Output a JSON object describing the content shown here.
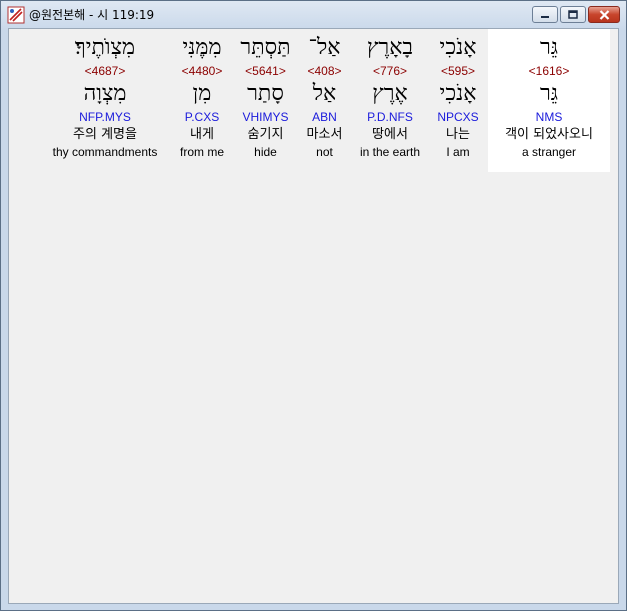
{
  "window": {
    "title": "@원전본해 - 시 119:19",
    "controls": [
      "minimize",
      "maximize",
      "close"
    ]
  },
  "words": [
    {
      "hebrew": "גֵּר",
      "strong": "<1616>",
      "lemma": "גֵּר",
      "morph": "NMS",
      "korean": "객이 되었사오니",
      "english": "a stranger",
      "selected": true
    },
    {
      "hebrew": "אָנֹכִי",
      "strong": "<595>",
      "lemma": "אָנֹכִי",
      "morph": "NPCXS",
      "korean": "나는",
      "english": "I am",
      "selected": false
    },
    {
      "hebrew": "בָאָרֶץ",
      "strong": "<776>",
      "lemma": "אֶרֶץ",
      "morph": "P.D.NFS",
      "korean": "땅에서",
      "english": "in the earth",
      "selected": false
    },
    {
      "hebrew": "אַל־",
      "strong": "<408>",
      "lemma": "אַל",
      "morph": "ABN",
      "korean": "마소서",
      "english": "not",
      "selected": false
    },
    {
      "hebrew": "תַּסְתֵּר",
      "strong": "<5641>",
      "lemma": "סָתַר",
      "morph": "VHIMYS",
      "korean": "숨기지",
      "english": "hide",
      "selected": false
    },
    {
      "hebrew": "מִמֶּנִּי",
      "strong": "<4480>",
      "lemma": "מִן",
      "morph": "P.CXS",
      "korean": "내게",
      "english": "from me",
      "selected": false
    },
    {
      "hebrew": "מִצְוֺתֶיךָ׃",
      "strong": "<4687>",
      "lemma": "מִצְוָה",
      "morph": "NFP.MYS",
      "korean": "주의 계명을",
      "english": "thy commandments",
      "selected": false
    }
  ]
}
